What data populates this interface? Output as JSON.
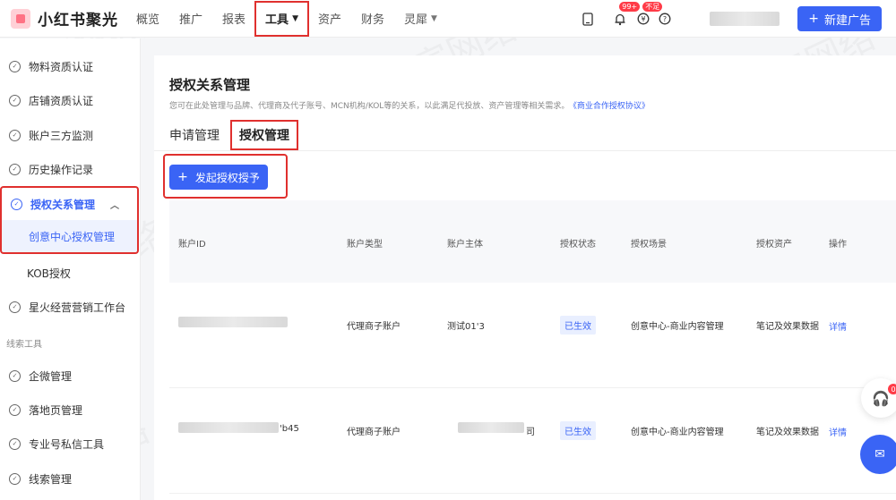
{
  "brand": {
    "name": "小红书聚光"
  },
  "nav": {
    "items": [
      {
        "label": "概览"
      },
      {
        "label": "推广"
      },
      {
        "label": "报表"
      },
      {
        "label": "工具",
        "active": true
      },
      {
        "label": "资产"
      },
      {
        "label": "财务"
      },
      {
        "label": "灵犀"
      }
    ]
  },
  "header": {
    "notify_badge": "99+",
    "balance_badge": "不足",
    "new_ad_label": "新建广告"
  },
  "sidebar": {
    "items": [
      {
        "label": "物料资质认证"
      },
      {
        "label": "店铺资质认证"
      },
      {
        "label": "账户三方监测"
      },
      {
        "label": "历史操作记录"
      },
      {
        "label": "授权关系管理"
      },
      {
        "label": "创意中心授权管理"
      },
      {
        "label": "KOB授权"
      },
      {
        "label": "星火经营营销工作台"
      },
      {
        "label": "企微管理"
      },
      {
        "label": "落地页管理"
      },
      {
        "label": "专业号私信工具"
      },
      {
        "label": "线索管理"
      }
    ],
    "section_label": "线索工具"
  },
  "main": {
    "title": "授权关系管理",
    "description": "您可在此处管理与品牌、代理商及代子账号、MCN机构/KOL等的关系，以此满足代投放、资产管理等相关需求。",
    "agreement_link": "《商业合作授权协议》",
    "tabs": [
      {
        "label": "申请管理"
      },
      {
        "label": "授权管理",
        "active": true
      }
    ],
    "primary_button": "发起授权授予",
    "table": {
      "headers": [
        "账户ID",
        "账户类型",
        "账户主体",
        "授权状态",
        "授权场景",
        "授权资产",
        "操作"
      ],
      "rows": [
        {
          "account_id_suffix": "",
          "account_type": "代理商子账户",
          "account_subject": "测试01'3",
          "status": "已生效",
          "scene": "创意中心-商业内容管理",
          "assets": "笔记及效果数据",
          "action": "详情"
        },
        {
          "account_id_suffix": "'b45",
          "account_type": "代理商子账户",
          "account_subject_suffix": "司",
          "status": "已生效",
          "scene": "创意中心-商业内容管理",
          "assets": "笔记及效果数据",
          "action": "详情"
        }
      ]
    }
  },
  "floating": {
    "support_badge": "0"
  },
  "watermark": "巨宣网络",
  "colors": {
    "primary": "#3a64f5",
    "highlight": "#e0302e",
    "badge": "#ff3b47"
  }
}
